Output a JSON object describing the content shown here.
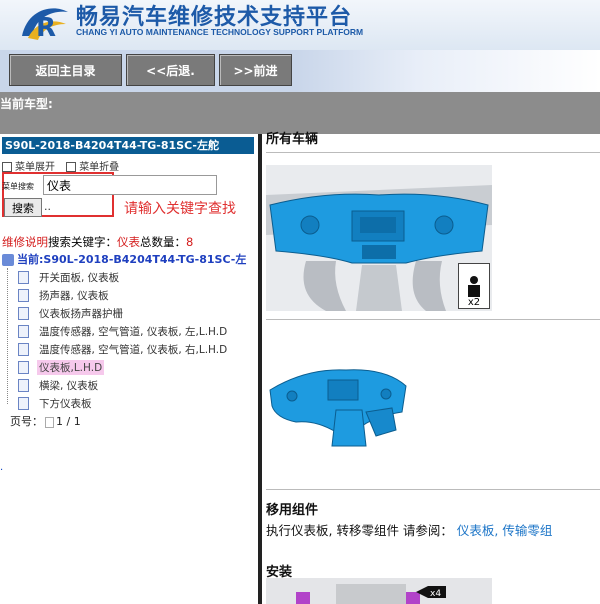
{
  "header": {
    "title": "畅易汽车维修技术支持平台",
    "subtitle": "CHANG YI AUTO MAINTENANCE TECHNOLOGY SUPPORT PLATFORM",
    "accent_color": "#1d5aa8"
  },
  "nav": {
    "buttons": [
      "返回主目录",
      "<<后退.",
      ">>前进"
    ]
  },
  "current_model": {
    "label": "当前车型:"
  },
  "tree": {
    "header": "S90L-2018-B4204T44-TG-81SC-左舵",
    "expand_menu": "菜单展开",
    "collapse_menu": "菜单折叠",
    "search_label": "菜单搜索",
    "search_value": "仪表",
    "search_button": "搜索",
    "search_dots": "..",
    "hint": "请输入关键字查找",
    "result_prefix": "维修说明",
    "result_keyword_label": "搜索关键字：",
    "result_keyword": "仪表",
    "result_count_label": "总数量：",
    "result_count": "8",
    "root": "当前:S90L-2018-B4204T44-TG-81SC-左",
    "items": [
      "开关面板, 仪表板",
      "扬声器, 仪表板",
      "仪表板扬声器护栅",
      "温度传感器, 空气管道, 仪表板, 左,L.H.D",
      "温度传感器, 空气管道, 仪表板, 右,L.H.D",
      "仪表板,L.H.D",
      "横梁, 仪表板",
      "下方仪表板"
    ],
    "selected_index": 5,
    "pager_label": "页号：",
    "pager_value": "1 / 1",
    "stray_char": "."
  },
  "content": {
    "section1": "所有车辆",
    "badge": "x2",
    "section2": "移用组件",
    "body_prefix": "执行仪表板, 转移零组件 请参阅：",
    "link1": "仪表板,",
    "link2": "传输零组",
    "section3": "安装",
    "badge2": "x4",
    "part_color": "#1e9be0"
  }
}
